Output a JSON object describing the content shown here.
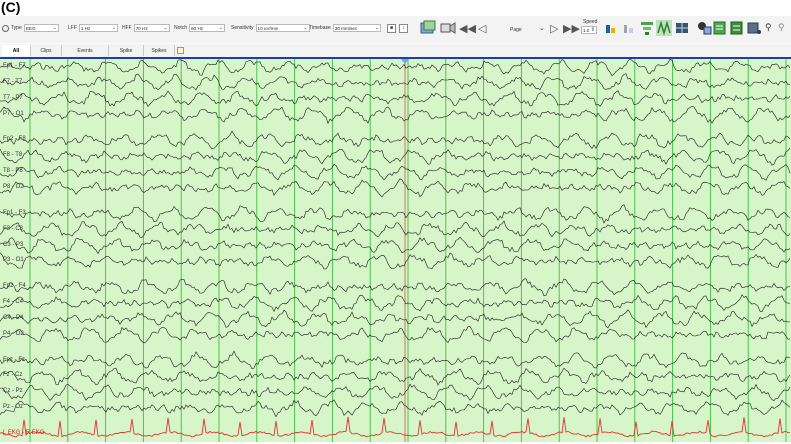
{
  "figure_label": "(C)",
  "toolbar": {
    "type_label": "Type",
    "type_value": "EEG",
    "lff_label": "LFF",
    "lff_value": "1 Hz",
    "hff_label": "HFF",
    "hff_value": "70 Hz",
    "notch_label": "Notch",
    "notch_value": "60 Hz",
    "sensitivity_label": "Sensitivity",
    "sensitivity_value": "10 uV/mm",
    "timebase_label": "Timebase",
    "timebase_value": "30 mm/sec",
    "page_label": "Page",
    "speed_label": "Speed",
    "speed_value": "1.0"
  },
  "tabs": [
    "All",
    "Clips",
    "Events",
    "Spike",
    "Spikes"
  ],
  "channels": [
    {
      "label": "Fp1 - F7",
      "group": 0
    },
    {
      "label": "F7 - T7",
      "group": 0
    },
    {
      "label": "T7 - P7",
      "group": 0
    },
    {
      "label": "P7 - O1",
      "group": 0
    },
    {
      "label": "Fp2 - F8",
      "group": 1
    },
    {
      "label": "F8 - T8",
      "group": 1
    },
    {
      "label": "T8 - P8",
      "group": 1
    },
    {
      "label": "P8 - O2",
      "group": 1
    },
    {
      "label": "Fp1 - F3",
      "group": 2
    },
    {
      "label": "F3 - C3",
      "group": 2
    },
    {
      "label": "C3 - P3",
      "group": 2
    },
    {
      "label": "P3 - O1",
      "group": 2
    },
    {
      "label": "Fp2 - F4",
      "group": 3
    },
    {
      "label": "F4 - C4",
      "group": 3
    },
    {
      "label": "C4 - P4",
      "group": 3
    },
    {
      "label": "P4 - O2",
      "group": 3
    },
    {
      "label": "Fpz - Fz",
      "group": 4
    },
    {
      "label": "Fz - Cz",
      "group": 4
    },
    {
      "label": "Cz - Pz",
      "group": 4
    },
    {
      "label": "Pz - Oz",
      "group": 4
    },
    {
      "label": "L EKG - R EKG",
      "group": 5
    }
  ],
  "colors": {
    "trace_bg": "#d6f5c8",
    "gridline": "#3fbf3f",
    "cursor": "#e86a6a",
    "trace": "#1a1a1a",
    "ekg_trace": "#e83030",
    "selection_bar": "#1a3fb0"
  }
}
